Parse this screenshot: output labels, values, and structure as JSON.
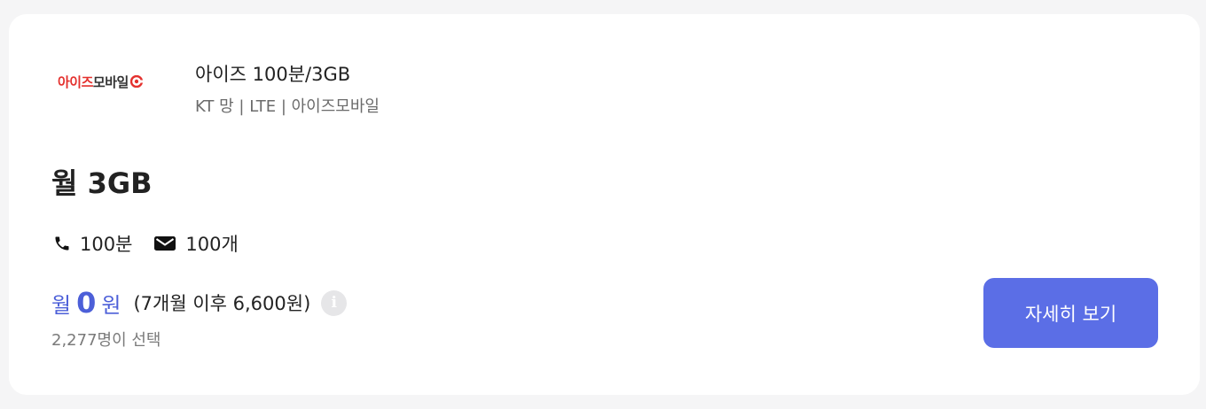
{
  "logo": {
    "text_red": "아이즈",
    "text_dark": "모바일",
    "accent_color": "#e4312e"
  },
  "plan": {
    "name": "아이즈 100분/3GB",
    "network_info": "KT 망 | LTE | 아이즈모바일",
    "data_amount": "월 3GB"
  },
  "features": {
    "call": "100분",
    "sms": "100개",
    "call_icon": "phone-icon",
    "sms_icon": "mail-icon"
  },
  "price": {
    "prefix": "월",
    "value": "0",
    "suffix": "원",
    "after_promo": "(7개월 이후 6,600원)",
    "info_icon": "info-icon",
    "accent_color": "#4c5fd8"
  },
  "chosen_count": "2,277명이 선택",
  "button": {
    "label": "자세히 보기",
    "color": "#5b6ee6"
  }
}
